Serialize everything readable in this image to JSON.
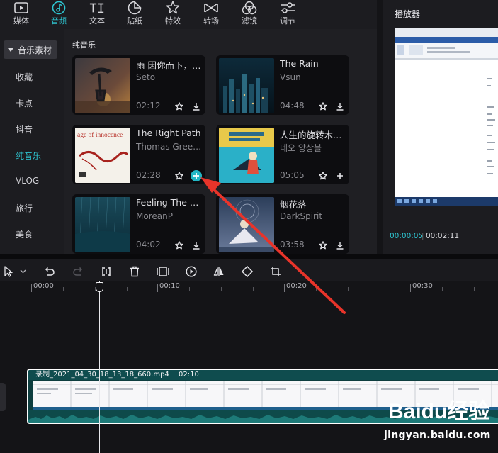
{
  "toolbar": {
    "tabs": [
      {
        "label": "媒体",
        "icon": "media-icon"
      },
      {
        "label": "音频",
        "icon": "audio-icon"
      },
      {
        "label": "文本",
        "icon": "text-icon"
      },
      {
        "label": "贴纸",
        "icon": "sticker-icon"
      },
      {
        "label": "特效",
        "icon": "effects-icon"
      },
      {
        "label": "转场",
        "icon": "transition-icon"
      },
      {
        "label": "滤镜",
        "icon": "filter-icon"
      },
      {
        "label": "调节",
        "icon": "adjust-icon"
      }
    ],
    "active_tab": "音频"
  },
  "sidebar": {
    "header": "音乐素材",
    "items": [
      {
        "label": "收藏"
      },
      {
        "label": "卡点"
      },
      {
        "label": "抖音"
      },
      {
        "label": "纯音乐"
      },
      {
        "label": "VLOG"
      },
      {
        "label": "旅行"
      },
      {
        "label": "美食"
      }
    ],
    "active_item": "纯音乐"
  },
  "content": {
    "section_title": "纯音乐",
    "tracks": [
      {
        "title": "雨 因你而下，…",
        "artist": "Seto",
        "duration": "02:12",
        "action": "download"
      },
      {
        "title": "The Rain",
        "artist": "Vsun",
        "duration": "04:48",
        "action": "download"
      },
      {
        "title": "The Right Path",
        "artist": "Thomas Green…",
        "duration": "02:28",
        "action": "add",
        "cover_text": "age of innocence"
      },
      {
        "title": "人生的旋转木马…",
        "artist": "네오 앙상블",
        "duration": "05:05",
        "action": "add"
      },
      {
        "title": "Feeling The Rain",
        "artist": "MoreanP",
        "duration": "04:02",
        "action": "download"
      },
      {
        "title": "烟花落",
        "artist": "DarkSpirit",
        "duration": "03:58",
        "action": "download"
      }
    ]
  },
  "player": {
    "title": "播放器",
    "current_time": "00:00:05",
    "total_time": "00:02:11"
  },
  "timeline": {
    "ruler_labels": [
      "00:00",
      "00:10",
      "00:20",
      "00:30"
    ],
    "clip": {
      "filename": "录制_2021_04_30_18_13_18_660.mp4",
      "duration": "02:10"
    }
  },
  "watermark": {
    "brand": "Baidu经验",
    "url": "jingyan.baidu.com"
  },
  "colors": {
    "accent": "#2ec7d3",
    "clip_bg": "#0e3e3f",
    "annotation_arrow": "#e8342a"
  }
}
